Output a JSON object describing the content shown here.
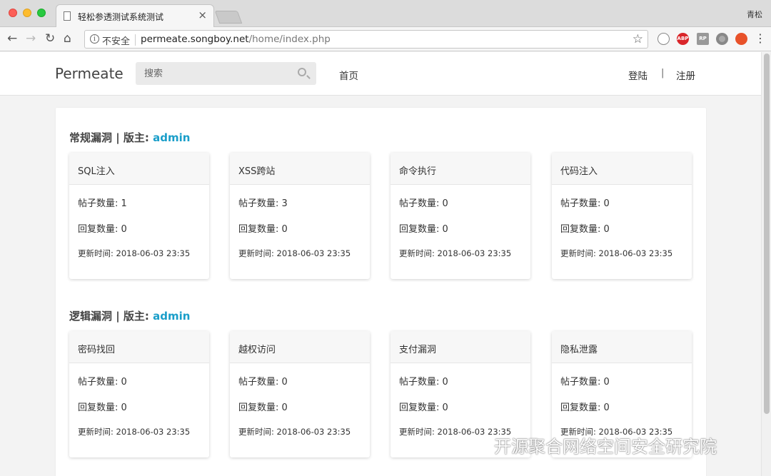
{
  "browser": {
    "tab_title": "轻松参透测试系统测试",
    "tab_close": "×",
    "profile": "青松",
    "insecure_label": "不安全",
    "url_host": "permeate.songboy.net",
    "url_path": "/home/index.php",
    "ext_abp": "ABP",
    "ext_rp": "RP"
  },
  "site": {
    "brand": "Permeate",
    "search_placeholder": "搜索",
    "nav_home": "首页",
    "login": "登陆",
    "divider": "|",
    "register": "注册"
  },
  "sections": [
    {
      "title": "常规漏洞 | 版主: ",
      "moderator": "admin",
      "cards": [
        {
          "name": "SQL注入",
          "posts": "帖子数量: 1",
          "replies": "回复数量: 0",
          "updated": "更新时间: 2018-06-03 23:35"
        },
        {
          "name": "XSS跨站",
          "posts": "帖子数量: 3",
          "replies": "回复数量: 0",
          "updated": "更新时间: 2018-06-03 23:35"
        },
        {
          "name": "命令执行",
          "posts": "帖子数量: 0",
          "replies": "回复数量: 0",
          "updated": "更新时间: 2018-06-03 23:35"
        },
        {
          "name": "代码注入",
          "posts": "帖子数量: 0",
          "replies": "回复数量: 0",
          "updated": "更新时间: 2018-06-03 23:35"
        }
      ]
    },
    {
      "title": "逻辑漏洞 | 版主: ",
      "moderator": "admin",
      "cards": [
        {
          "name": "密码找回",
          "posts": "帖子数量: 0",
          "replies": "回复数量: 0",
          "updated": "更新时间: 2018-06-03 23:35"
        },
        {
          "name": "越权访问",
          "posts": "帖子数量: 0",
          "replies": "回复数量: 0",
          "updated": "更新时间: 2018-06-03 23:35"
        },
        {
          "name": "支付漏洞",
          "posts": "帖子数量: 0",
          "replies": "回复数量: 0",
          "updated": "更新时间: 2018-06-03 23:35"
        },
        {
          "name": "隐私泄露",
          "posts": "帖子数量: 0",
          "replies": "回复数量: 0",
          "updated": "更新时间: 2018-06-03 23:35"
        }
      ]
    }
  ],
  "watermark": "开源聚合网络空间安全研究院",
  "colors": {
    "moderator": "#1a9ec9",
    "panel": "#ffffff",
    "page_bg": "#f3f3f3"
  }
}
